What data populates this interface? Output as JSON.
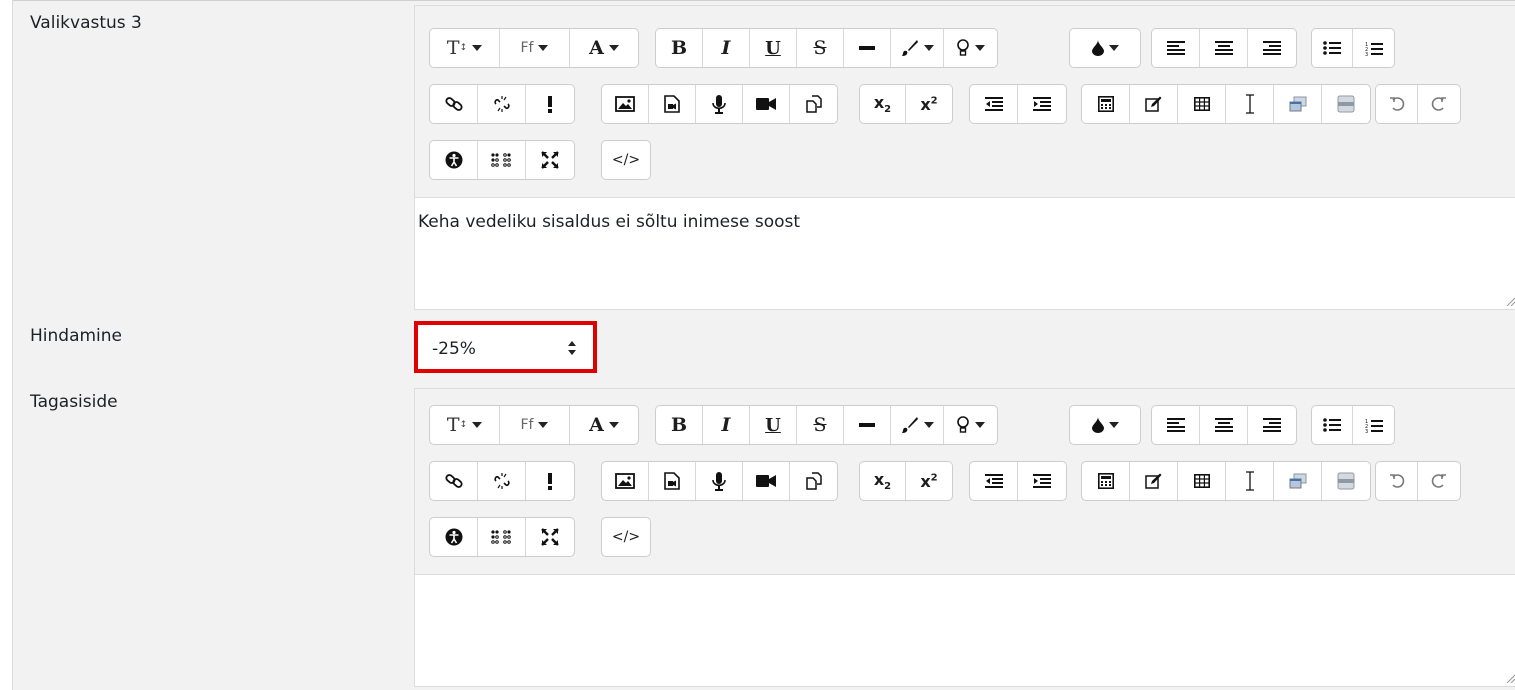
{
  "fields": {
    "choice": {
      "label": "Valikvastus 3",
      "content": "Keha vedeliku sisaldus ei sõltu inimese soost"
    },
    "grade": {
      "label": "Hindamine",
      "selected": "-25%"
    },
    "feedback": {
      "label": "Tagasiside",
      "content": ""
    }
  },
  "toolbar": {
    "row1": [
      {
        "group": [
          "font-size-dropdown",
          "font-family-dropdown",
          "font-color-text-dropdown"
        ]
      },
      {
        "group": [
          "bold",
          "italic",
          "underline",
          "strikethrough",
          "horizontal-rule",
          "brush-dropdown",
          "bulb-dropdown"
        ]
      },
      {
        "group": [
          "background-color-dropdown"
        ]
      },
      {
        "group": [
          "align-left",
          "align-center",
          "align-right"
        ]
      },
      {
        "group": [
          "bullet-list",
          "numbered-list"
        ]
      }
    ],
    "row2": [
      {
        "group": [
          "link",
          "unlink",
          "important"
        ]
      },
      {
        "group": [
          "image",
          "media",
          "record-audio",
          "record-video",
          "manage-files"
        ]
      },
      {
        "group": [
          "subscript",
          "superscript"
        ]
      },
      {
        "group": [
          "outdent",
          "indent"
        ]
      },
      {
        "group": [
          "calculator",
          "edit",
          "table",
          "text-cursor",
          "screen",
          "drawer"
        ]
      },
      {
        "group": [
          "undo",
          "redo"
        ]
      }
    ],
    "row3": [
      {
        "group": [
          "accessibility",
          "braille",
          "fullscreen"
        ]
      },
      {
        "group": [
          "html-source"
        ]
      }
    ],
    "glyphs": {
      "font_size": "T",
      "font_family": "Ff",
      "font_color": "A",
      "bold": "B",
      "italic": "I",
      "underline": "U",
      "strike": "S",
      "sub": "x",
      "sub_idx": "2",
      "sup": "x",
      "sup_idx": "2",
      "html": "</>"
    }
  },
  "colors": {
    "highlight_border": "#e00000",
    "panel_bg": "#f2f2f2"
  }
}
